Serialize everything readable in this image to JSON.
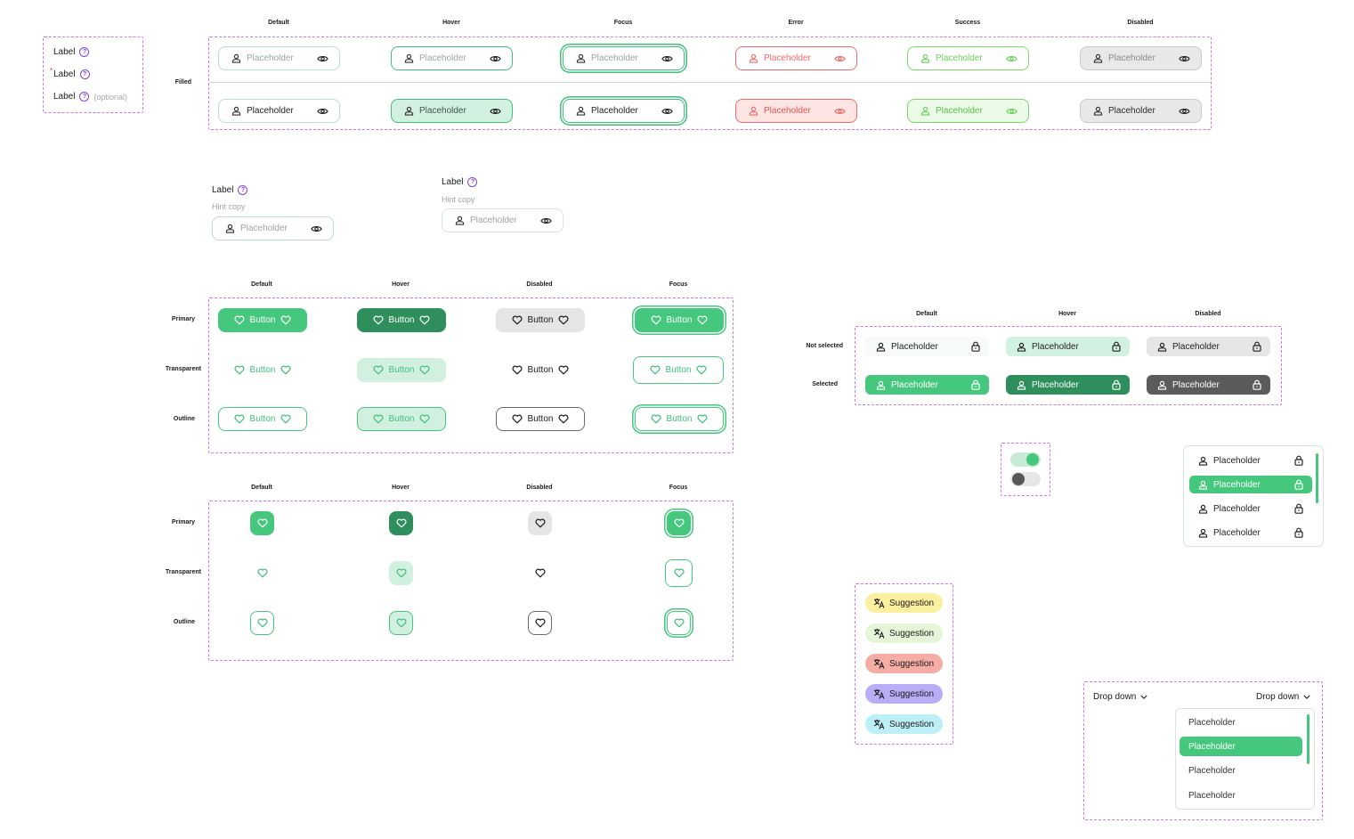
{
  "inputs": {
    "columns": [
      "Default",
      "Hover",
      "Focus",
      "Error",
      "Success",
      "Disabled"
    ],
    "row_label": "Filled",
    "placeholder": "Placeholder"
  },
  "labels": {
    "label": "Label",
    "required_mark": "*",
    "optional": "(optional)",
    "hint": "Hint copy",
    "question_mark": "?"
  },
  "buttons": {
    "columns": [
      "Default",
      "Hover",
      "Disabled",
      "Focus"
    ],
    "rows": [
      "Primary",
      "Transparent",
      "Outline"
    ],
    "label": "Button"
  },
  "selects": {
    "columns": [
      "Default",
      "Hover",
      "Disabled"
    ],
    "rows": [
      "Not selected",
      "Selected"
    ],
    "placeholder": "Placeholder"
  },
  "toggles": [
    {
      "state": "on"
    },
    {
      "state": "off"
    }
  ],
  "list": {
    "items": [
      "Placeholder",
      "Placeholder",
      "Placeholder",
      "Placeholder"
    ],
    "active_index": 1
  },
  "suggestions": {
    "label": "Suggestion",
    "colors": [
      "#fbf0a0",
      "#e5f5d9",
      "#f6ada6",
      "#b8aef5",
      "#bdf0f6"
    ]
  },
  "dropdown": {
    "left_label": "Drop down",
    "right_label": "Drop down",
    "items": [
      "Placeholder",
      "Placeholder",
      "Placeholder",
      "Placeholder"
    ],
    "active_index": 1
  },
  "colors": {
    "accent": "#45c77e",
    "accent_dark": "#2e8f5c",
    "frame": "#c779e6",
    "error": "#ef6b6b",
    "success": "#7bd96a"
  }
}
